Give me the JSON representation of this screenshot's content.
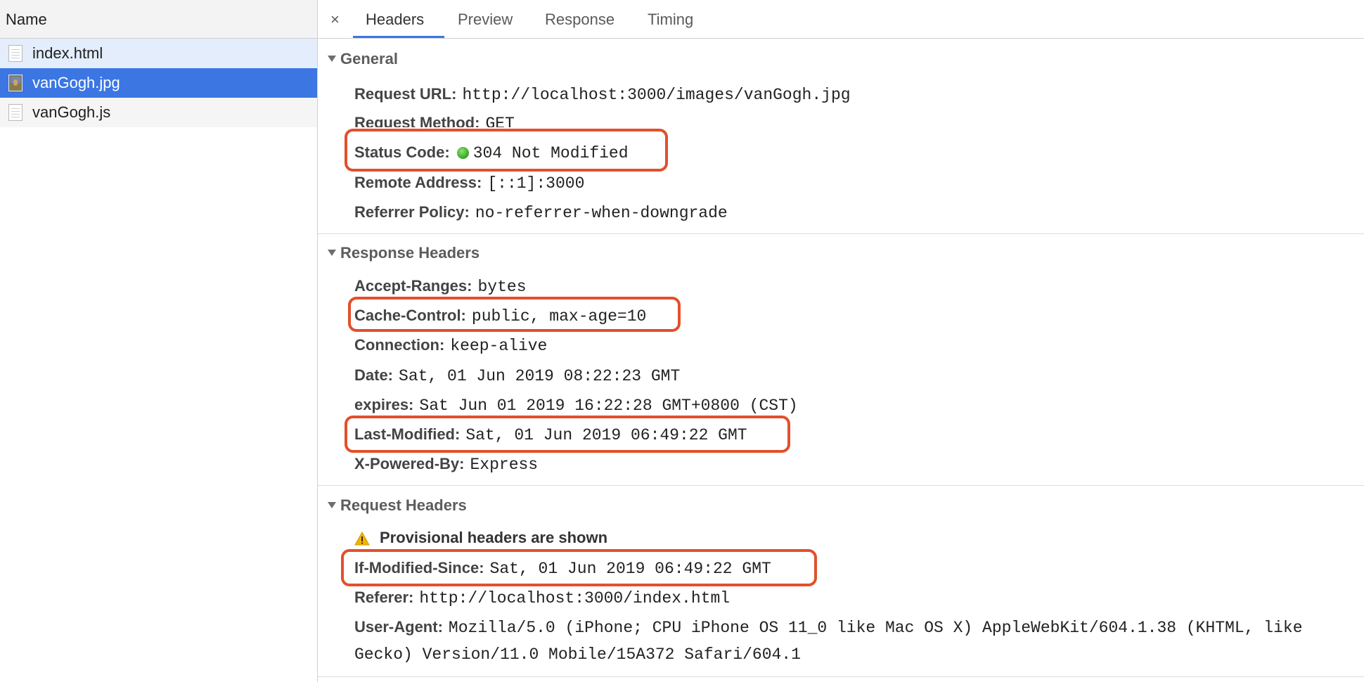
{
  "left_pane": {
    "header": "Name",
    "files": [
      {
        "name": "index.html",
        "icon": "document-icon",
        "state": "hover"
      },
      {
        "name": "vanGogh.jpg",
        "icon": "image-thumbnail-icon",
        "state": "selected"
      },
      {
        "name": "vanGogh.js",
        "icon": "document-icon",
        "state": "normal"
      }
    ]
  },
  "tabs": {
    "close": "×",
    "items": [
      "Headers",
      "Preview",
      "Response",
      "Timing"
    ],
    "active": "Headers"
  },
  "general": {
    "title": "General",
    "request_url": {
      "key": "Request URL:",
      "value": "http://localhost:3000/images/vanGogh.jpg"
    },
    "request_method": {
      "key": "Request Method:",
      "value": "GET"
    },
    "status_code": {
      "key": "Status Code:",
      "value": "304 Not Modified"
    },
    "remote_address": {
      "key": "Remote Address:",
      "value": "[::1]:3000"
    },
    "referrer_policy": {
      "key": "Referrer Policy:",
      "value": "no-referrer-when-downgrade"
    }
  },
  "response_headers": {
    "title": "Response Headers",
    "accept_ranges": {
      "key": "Accept-Ranges:",
      "value": "bytes"
    },
    "cache_control": {
      "key": "Cache-Control:",
      "value": "public, max-age=10"
    },
    "connection": {
      "key": "Connection:",
      "value": "keep-alive"
    },
    "date": {
      "key": "Date:",
      "value": "Sat, 01 Jun 2019 08:22:23 GMT"
    },
    "expires": {
      "key": "expires:",
      "value": "Sat Jun 01 2019 16:22:28 GMT+0800 (CST)"
    },
    "last_modified": {
      "key": "Last-Modified:",
      "value": "Sat, 01 Jun 2019 06:49:22 GMT"
    },
    "x_powered_by": {
      "key": "X-Powered-By:",
      "value": "Express"
    }
  },
  "request_headers": {
    "title": "Request Headers",
    "provisional": "Provisional headers are shown",
    "if_modified_since": {
      "key": "If-Modified-Since:",
      "value": "Sat, 01 Jun 2019 06:49:22 GMT"
    },
    "referer": {
      "key": "Referer:",
      "value": "http://localhost:3000/index.html"
    },
    "user_agent": {
      "key": "User-Agent:",
      "value": "Mozilla/5.0 (iPhone; CPU iPhone OS 11_0 like Mac OS X) AppleWebKit/604.1.38 (KHTML, like",
      "value_cont": "Gecko) Version/11.0 Mobile/15A372 Safari/604.1"
    }
  },
  "colors": {
    "selected_row": "#3b76e2",
    "hover_row": "#e3edfb",
    "highlight_box": "#e2502b",
    "status_ok": "#3fae2a",
    "warning": "#f0b400"
  }
}
